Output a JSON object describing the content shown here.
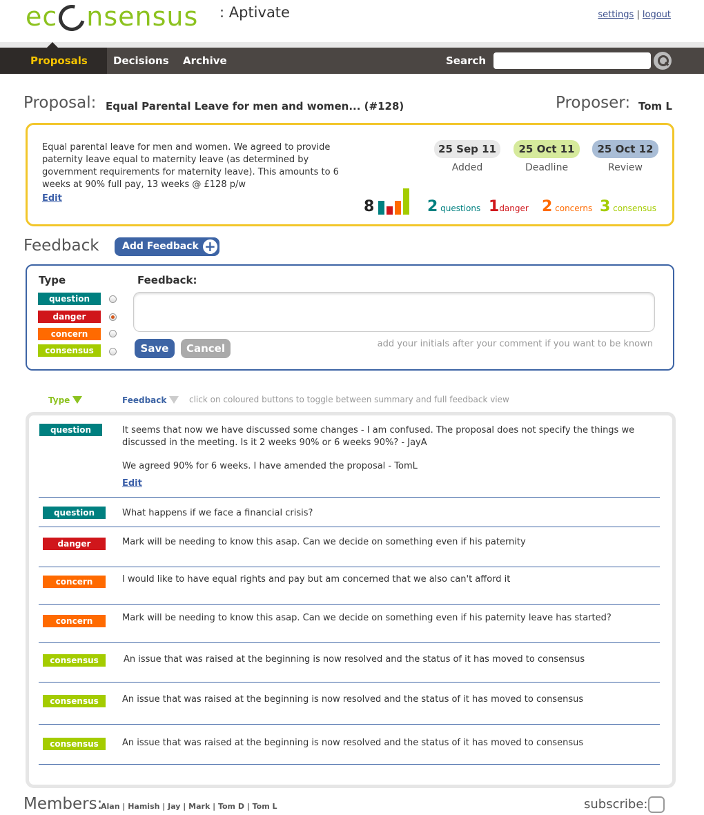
{
  "header": {
    "logo_pre": "ec",
    "logo_post": "nsensus",
    "org": ": Aptivate",
    "settings_label": "settings",
    "separator": "|",
    "logout_label": "logout"
  },
  "nav": {
    "items": [
      {
        "label": "Proposals"
      },
      {
        "label": "Decisions"
      },
      {
        "label": "Archive"
      }
    ],
    "search_label": "Search",
    "search_value": ""
  },
  "proposal": {
    "heading": "Proposal:",
    "title": "Equal Parental Leave for men and women... (#128)",
    "proposer_heading": "Proposer:",
    "proposer": "Tom L",
    "description": "Equal parental leave for men and women. We agreed to provide paternity leave equal to maternity leave (as determined by government requirements for maternity leave).  This amounts to 6 weeks at 90% full pay, 13 weeks @ £128 p/w",
    "edit_label": "Edit",
    "dates": [
      {
        "value": "25 Sep 11",
        "caption": "Added",
        "color": "#e8e8e8"
      },
      {
        "value": "25 Oct 11",
        "caption": "Deadline",
        "color": "#d6ea9c"
      },
      {
        "value": "25 Oct 12",
        "caption": "Review",
        "color": "#a9bdd6"
      }
    ],
    "stats": {
      "total": "8",
      "questions": {
        "count": "2",
        "label": "questions",
        "color": "#008080"
      },
      "danger": {
        "count": "1",
        "label": "danger",
        "color": "#d0161b"
      },
      "concerns": {
        "count": "2",
        "label": "concerns",
        "color": "#ff6a00"
      },
      "consensus": {
        "count": "3",
        "label": "consensus",
        "color": "#a4cc00"
      }
    }
  },
  "feedback_form": {
    "heading": "Feedback",
    "add_label": "Add Feedback",
    "type_label": "Type",
    "feedback_label": "Feedback:",
    "types": [
      {
        "label": "question",
        "color": "#008080",
        "checked": false
      },
      {
        "label": "danger",
        "color": "#d0161b",
        "checked": true
      },
      {
        "label": "concern",
        "color": "#ff6a00",
        "checked": false
      },
      {
        "label": "consensus",
        "color": "#a4cc00",
        "checked": false
      }
    ],
    "textarea_value": "",
    "save_label": "Save",
    "cancel_label": "Cancel",
    "hint": "add your initials after your comment if you want to be known"
  },
  "list_header": {
    "type_label": "Type",
    "feedback_label": "Feedback",
    "hint": "click on coloured buttons to toggle between summary and full feedback view"
  },
  "feedback_items": [
    {
      "type": "question",
      "color": "#008080",
      "text": "It seems that now we have discussed some changes - I am confused. The proposal does not specify the things we discussed in the meeting. Is it 2 weeks 90% or 6 weeks 90%? - JayA",
      "reply": "We agreed 90% for 6 weeks. I have amended the proposal - TomL",
      "edit_label": "Edit"
    },
    {
      "type": "question",
      "color": "#008080",
      "text": "What happens if we face a financial crisis?"
    },
    {
      "type": "danger",
      "color": "#d0161b",
      "text": "Mark will be needing to know this asap. Can we decide on something even if his paternity"
    },
    {
      "type": "concern",
      "color": "#ff6a00",
      "text": "I would like to have equal rights and pay but am concerned that we also can't afford it"
    },
    {
      "type": "concern",
      "color": "#ff6a00",
      "text": "Mark will be needing to know this asap. Can we decide on something even if his paternity leave has started?"
    },
    {
      "type": "consensus",
      "color": "#a4cc00",
      "text": "An issue that was raised at the beginning is now resolved and the status of it has moved to consensus"
    },
    {
      "type": "consensus",
      "color": "#a4cc00",
      "text": "An issue that was raised at the beginning is now resolved and the status of it has moved to consensus"
    },
    {
      "type": "consensus",
      "color": "#a4cc00",
      "text": "An issue that was raised at the beginning is now resolved and the status of it has moved to consensus"
    }
  ],
  "footer": {
    "members_heading": "Members:",
    "members": "Alan | Hamish | Jay | Mark | Tom D | Tom L",
    "subscribe_label": "subscribe:"
  }
}
